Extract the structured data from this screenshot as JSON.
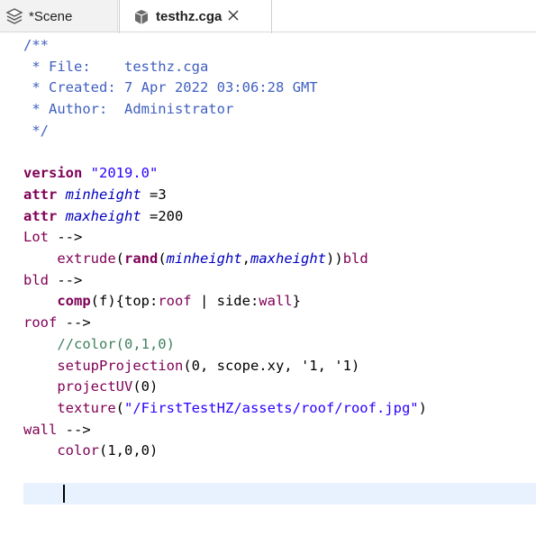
{
  "tabs": [
    {
      "label": "*Scene",
      "icon": "scene-layers-icon"
    },
    {
      "label": "testhz.cga",
      "icon": "cga-rule-file-icon",
      "close_icon": "close-icon"
    }
  ],
  "editor": {
    "file": "testhz.cga",
    "lines": [
      {
        "segments": [
          {
            "text": "/**",
            "style": "c"
          }
        ]
      },
      {
        "segments": [
          {
            "text": " * File:    testhz.cga",
            "style": "c"
          }
        ]
      },
      {
        "segments": [
          {
            "text": " * Created: 7 Apr 2022 03:06:28 GMT",
            "style": "c"
          }
        ]
      },
      {
        "segments": [
          {
            "text": " * Author:  Administrator",
            "style": "c"
          }
        ]
      },
      {
        "segments": [
          {
            "text": " */",
            "style": "c"
          }
        ]
      },
      {
        "segments": []
      },
      {
        "segments": [
          {
            "text": "version ",
            "style": "kw"
          },
          {
            "text": "\"2019.0\"",
            "style": "str"
          }
        ]
      },
      {
        "segments": [
          {
            "text": "attr ",
            "style": "kw"
          },
          {
            "text": "minheight",
            "style": "var"
          },
          {
            "text": " =3",
            "style": "plain"
          }
        ]
      },
      {
        "segments": [
          {
            "text": "attr ",
            "style": "kw"
          },
          {
            "text": "maxheight",
            "style": "var"
          },
          {
            "text": " =200",
            "style": "plain"
          }
        ]
      },
      {
        "segments": [
          {
            "text": "Lot",
            "style": "rule"
          },
          {
            "text": " -->",
            "style": "arrow"
          }
        ]
      },
      {
        "segments": [
          {
            "text": "    ",
            "style": "plain"
          },
          {
            "text": "extrude",
            "style": "fn"
          },
          {
            "text": "(",
            "style": "plain"
          },
          {
            "text": "rand",
            "style": "bfn"
          },
          {
            "text": "(",
            "style": "plain"
          },
          {
            "text": "minheight",
            "style": "var"
          },
          {
            "text": ",",
            "style": "plain"
          },
          {
            "text": "maxheight",
            "style": "var"
          },
          {
            "text": "))",
            "style": "plain"
          },
          {
            "text": "bld",
            "style": "rule"
          }
        ]
      },
      {
        "segments": [
          {
            "text": "bld",
            "style": "rule"
          },
          {
            "text": " -->",
            "style": "arrow"
          }
        ]
      },
      {
        "segments": [
          {
            "text": "    ",
            "style": "plain"
          },
          {
            "text": "comp",
            "style": "bfn"
          },
          {
            "text": "(f){top:",
            "style": "plain"
          },
          {
            "text": "roof",
            "style": "rule"
          },
          {
            "text": " | side:",
            "style": "plain"
          },
          {
            "text": "wall",
            "style": "rule"
          },
          {
            "text": "}",
            "style": "plain"
          }
        ]
      },
      {
        "segments": [
          {
            "text": "roof",
            "style": "rule"
          },
          {
            "text": " -->",
            "style": "arrow"
          }
        ]
      },
      {
        "segments": [
          {
            "text": "    ",
            "style": "plain"
          },
          {
            "text": "//color(0,1,0)",
            "style": "lc"
          }
        ]
      },
      {
        "segments": [
          {
            "text": "    ",
            "style": "plain"
          },
          {
            "text": "setupProjection",
            "style": "fn"
          },
          {
            "text": "(0, scope.xy, '1, '1)",
            "style": "plain"
          }
        ]
      },
      {
        "segments": [
          {
            "text": "    ",
            "style": "plain"
          },
          {
            "text": "projectUV",
            "style": "fn"
          },
          {
            "text": "(0)",
            "style": "plain"
          }
        ]
      },
      {
        "segments": [
          {
            "text": "    ",
            "style": "plain"
          },
          {
            "text": "texture",
            "style": "fn"
          },
          {
            "text": "(",
            "style": "plain"
          },
          {
            "text": "\"/FirstTestHZ/assets/roof/roof.jpg\"",
            "style": "str"
          },
          {
            "text": ")",
            "style": "plain"
          }
        ]
      },
      {
        "segments": [
          {
            "text": "wall",
            "style": "rule"
          },
          {
            "text": " -->",
            "style": "arrow"
          }
        ]
      },
      {
        "segments": [
          {
            "text": "    ",
            "style": "plain"
          },
          {
            "text": "color",
            "style": "fn"
          },
          {
            "text": "(1,0,0)",
            "style": "plain"
          }
        ]
      },
      {
        "segments": [
          {
            "text": "    ",
            "style": "plain"
          }
        ]
      }
    ],
    "current_line": 21
  }
}
